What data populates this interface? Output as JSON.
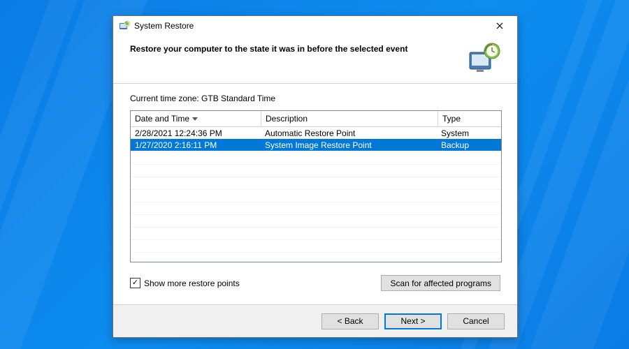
{
  "window": {
    "title": "System Restore"
  },
  "header": {
    "instruction": "Restore your computer to the state it was in before the selected event"
  },
  "body": {
    "timezone_label": "Current time zone: GTB Standard Time",
    "columns": {
      "date": "Date and Time",
      "desc": "Description",
      "type": "Type"
    },
    "rows": [
      {
        "date": "2/28/2021 12:24:36 PM",
        "desc": "Automatic Restore Point",
        "type": "System",
        "selected": false
      },
      {
        "date": "1/27/2020 2:16:11 PM",
        "desc": "System Image Restore Point",
        "type": "Backup",
        "selected": true
      }
    ],
    "show_more": {
      "label": "Show more restore points",
      "checked": true
    },
    "scan_button": "Scan for affected programs"
  },
  "footer": {
    "back": "< Back",
    "next": "Next >",
    "cancel": "Cancel"
  }
}
